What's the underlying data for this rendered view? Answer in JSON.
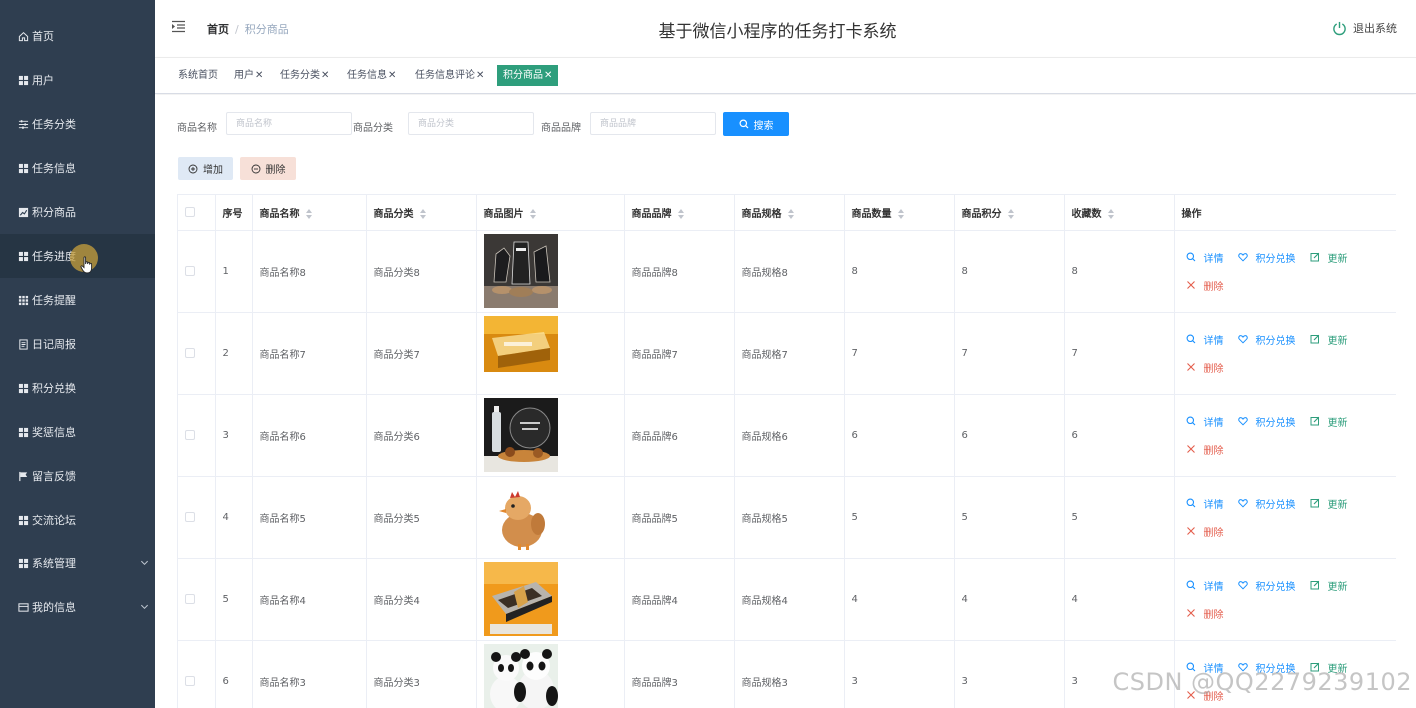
{
  "sidebar": {
    "items": [
      {
        "label": "首页",
        "icon": "home-icon"
      },
      {
        "label": "用户",
        "icon": "grid-icon"
      },
      {
        "label": "任务分类",
        "icon": "sliders-icon"
      },
      {
        "label": "任务信息",
        "icon": "grid-icon"
      },
      {
        "label": "积分商品",
        "icon": "chart-icon"
      },
      {
        "label": "任务进度",
        "icon": "grid-icon"
      },
      {
        "label": "任务提醒",
        "icon": "apps-icon"
      },
      {
        "label": "日记周报",
        "icon": "document-icon"
      },
      {
        "label": "积分兑换",
        "icon": "grid-icon"
      },
      {
        "label": "奖惩信息",
        "icon": "grid-icon"
      },
      {
        "label": "留言反馈",
        "icon": "flag-icon"
      },
      {
        "label": "交流论坛",
        "icon": "grid-icon"
      },
      {
        "label": "系统管理",
        "icon": "grid-icon"
      },
      {
        "label": "我的信息",
        "icon": "card-icon"
      }
    ]
  },
  "header": {
    "breadcrumb_home": "首页",
    "breadcrumb_sep": "/",
    "breadcrumb_current": "积分商品",
    "title": "基于微信小程序的任务打卡系统",
    "logout": "退出系统"
  },
  "tags": [
    {
      "label": "系统首页",
      "closable": false
    },
    {
      "label": "用户",
      "closable": true
    },
    {
      "label": "任务分类",
      "closable": true
    },
    {
      "label": "任务信息",
      "closable": true
    },
    {
      "label": "任务信息评论",
      "closable": true
    },
    {
      "label": "积分商品",
      "closable": true,
      "active": true
    }
  ],
  "search": {
    "name_label": "商品名称",
    "name_placeholder": "商品名称",
    "category_label": "商品分类",
    "category_placeholder": "商品分类",
    "brand_label": "商品品牌",
    "brand_placeholder": "商品品牌",
    "button": "搜索"
  },
  "actions": {
    "add": "增加",
    "delete": "删除"
  },
  "table": {
    "headers": {
      "index": "序号",
      "name": "商品名称",
      "category": "商品分类",
      "image": "商品图片",
      "brand": "商品品牌",
      "spec": "商品规格",
      "quantity": "商品数量",
      "points": "商品积分",
      "favorites": "收藏数",
      "ops": "操作"
    },
    "op_labels": {
      "detail": "详情",
      "exchange": "积分兑换",
      "update": "更新",
      "remove": "删除"
    },
    "rows": [
      {
        "index": "1",
        "name": "商品名称8",
        "category": "商品分类8",
        "image": "trophies",
        "brand": "商品品牌8",
        "spec": "商品规格8",
        "quantity": "8",
        "points": "8",
        "favorites": "8"
      },
      {
        "index": "2",
        "name": "商品名称7",
        "category": "商品分类7",
        "image": "crystal-gift",
        "brand": "商品品牌7",
        "spec": "商品规格7",
        "quantity": "7",
        "points": "7",
        "favorites": "7"
      },
      {
        "index": "3",
        "name": "商品名称6",
        "category": "商品分类6",
        "image": "desk-ornament",
        "brand": "商品品牌6",
        "spec": "商品规格6",
        "quantity": "6",
        "points": "6",
        "favorites": "6"
      },
      {
        "index": "4",
        "name": "商品名称5",
        "category": "商品分类5",
        "image": "chick-plush",
        "brand": "商品品牌5",
        "spec": "商品规格5",
        "quantity": "5",
        "points": "5",
        "favorites": "5"
      },
      {
        "index": "5",
        "name": "商品名称4",
        "category": "商品分类4",
        "image": "award-frame",
        "brand": "商品品牌4",
        "spec": "商品规格4",
        "quantity": "4",
        "points": "4",
        "favorites": "4"
      },
      {
        "index": "6",
        "name": "商品名称3",
        "category": "商品分类3",
        "image": "panda-plush",
        "brand": "商品品牌3",
        "spec": "商品规格3",
        "quantity": "3",
        "points": "3",
        "favorites": "3"
      }
    ]
  },
  "watermark": "CSDN @QQ2279239102",
  "colors": {
    "sidebar_bg": "#2f3e50",
    "primary": "#1890ff",
    "active_tag": "#2e9e7c",
    "danger": "#e45d4c"
  }
}
